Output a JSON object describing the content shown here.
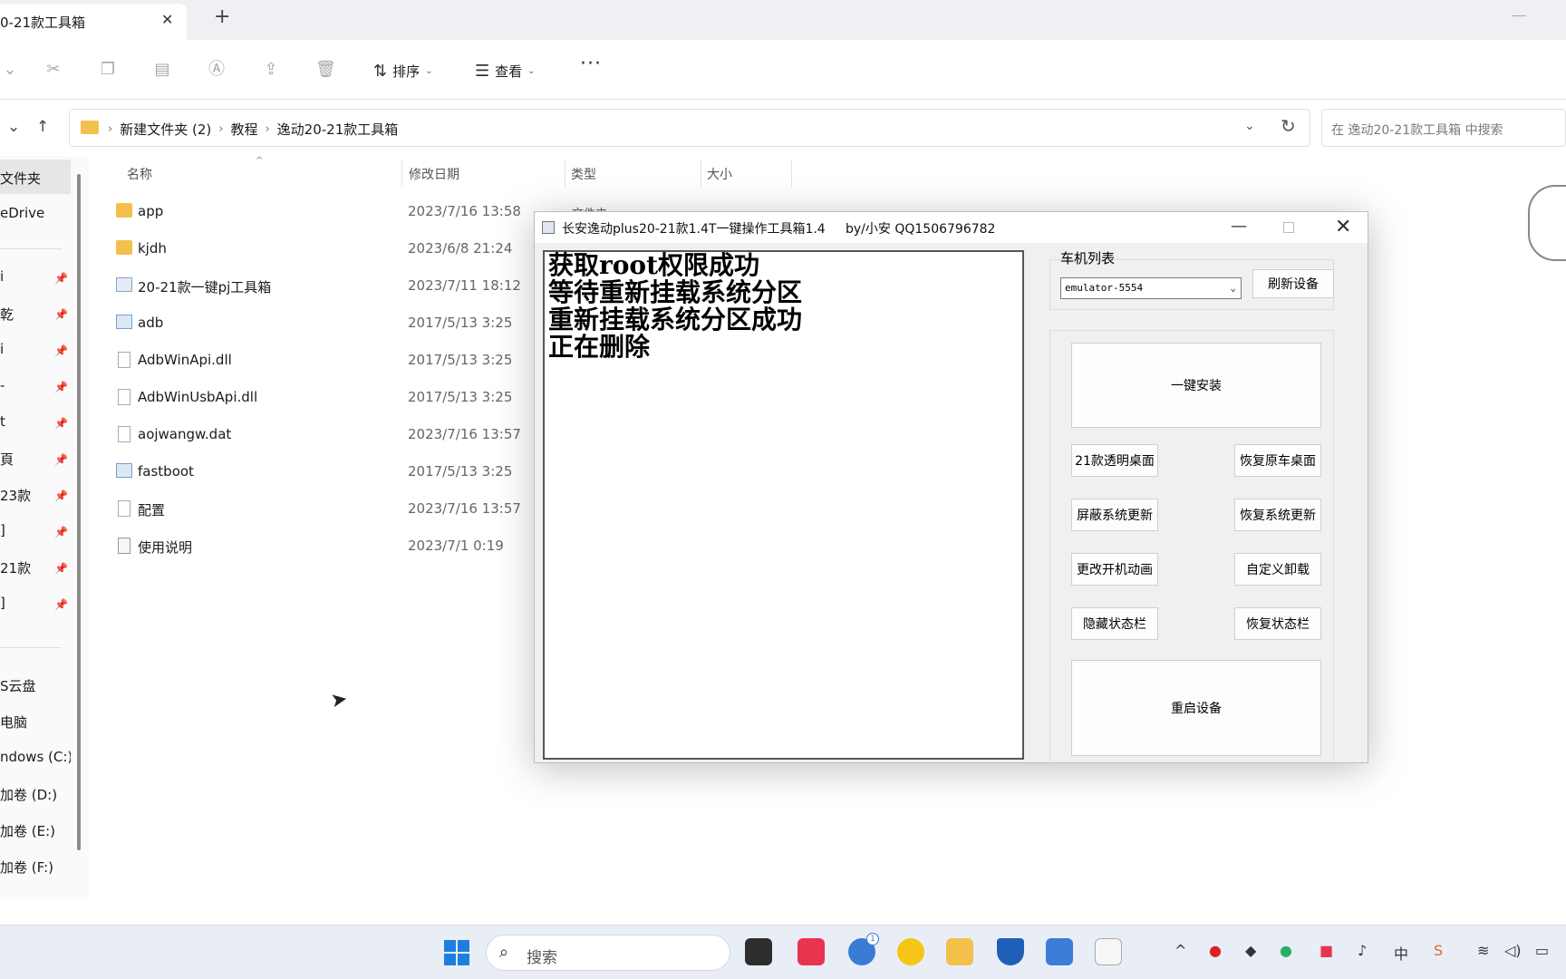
{
  "explorer": {
    "tab_title": "0-21款工具箱",
    "tab_close": "✕",
    "tab_new": "+",
    "commands": {
      "sort": "排序",
      "view": "查看",
      "more": "···"
    },
    "breadcrumbs": [
      "新建文件夹 (2)",
      "教程",
      "逸动20-21款工具箱"
    ],
    "search_placeholder": "在 逸动20-21款工具箱 中搜索",
    "columns": {
      "name": "名称",
      "date": "修改日期",
      "type": "类型",
      "size": "大小"
    },
    "partial_type": "文件夹",
    "files": [
      {
        "name": "app",
        "date": "2023/7/16 13:58",
        "icon": "folder-icon"
      },
      {
        "name": "kjdh",
        "date": "2023/6/8 21:24",
        "icon": "folder-icon"
      },
      {
        "name": "20-21款一键pj工具箱",
        "date": "2023/7/11 18:12",
        "icon": "exe-icon"
      },
      {
        "name": "adb",
        "date": "2017/5/13 3:25",
        "icon": "app-icon"
      },
      {
        "name": "AdbWinApi.dll",
        "date": "2017/5/13 3:25",
        "icon": "dll-icon"
      },
      {
        "name": "AdbWinUsbApi.dll",
        "date": "2017/5/13 3:25",
        "icon": "dll-icon"
      },
      {
        "name": "aojwangw.dat",
        "date": "2023/7/16 13:57",
        "icon": "file-icon"
      },
      {
        "name": "fastboot",
        "date": "2017/5/13 3:25",
        "icon": "app-icon"
      },
      {
        "name": "配置",
        "date": "2023/7/16 13:57",
        "icon": "settings-file-icon"
      },
      {
        "name": "使用说明",
        "date": "2023/7/1 0:19",
        "icon": "text-file-icon"
      }
    ],
    "sidebar": [
      {
        "label": "文件夹"
      },
      {
        "label": "eDrive"
      },
      {
        "label": "i"
      },
      {
        "label": "乾"
      },
      {
        "label": "i"
      },
      {
        "label": "-"
      },
      {
        "label": "t"
      },
      {
        "label": "頁"
      },
      {
        "label": "23款"
      },
      {
        "label": "]"
      },
      {
        "label": "21款"
      },
      {
        "label": "]"
      },
      {
        "label": "S云盘"
      },
      {
        "label": "电脑"
      },
      {
        "label": "ndows (C:)"
      },
      {
        "label": "加卷 (D:)"
      },
      {
        "label": "加卷 (E:)"
      },
      {
        "label": "加卷 (F:)"
      }
    ]
  },
  "tool": {
    "title": "长安逸动plus20-21款1.4T一键操作工具箱1.4",
    "author": "by/小安  QQ1506796782",
    "log_lines": [
      "获取root权限成功",
      "等待重新挂载系统分区",
      "重新挂载系统分区成功",
      "正在删除"
    ],
    "device_list_label": "车机列表",
    "device_selected": "emulator-5554",
    "buttons": {
      "refresh": "刷新设备",
      "install": "一键安装",
      "transparent_desktop": "21款透明桌面",
      "restore_desktop": "恢复原车桌面",
      "block_update": "屏蔽系统更新",
      "restore_update": "恢复系统更新",
      "change_boot_anim": "更改开机动画",
      "custom_uninstall": "自定义卸载",
      "hide_statusbar": "隐藏状态栏",
      "restore_statusbar": "恢复状态栏",
      "reboot": "重启设备"
    }
  },
  "taskbar": {
    "search_label": "搜索",
    "badge_count": "1",
    "colors": {
      "start": "#1c7fe0",
      "accent_red": "#e8344e",
      "folder": "#f2c04b"
    }
  }
}
